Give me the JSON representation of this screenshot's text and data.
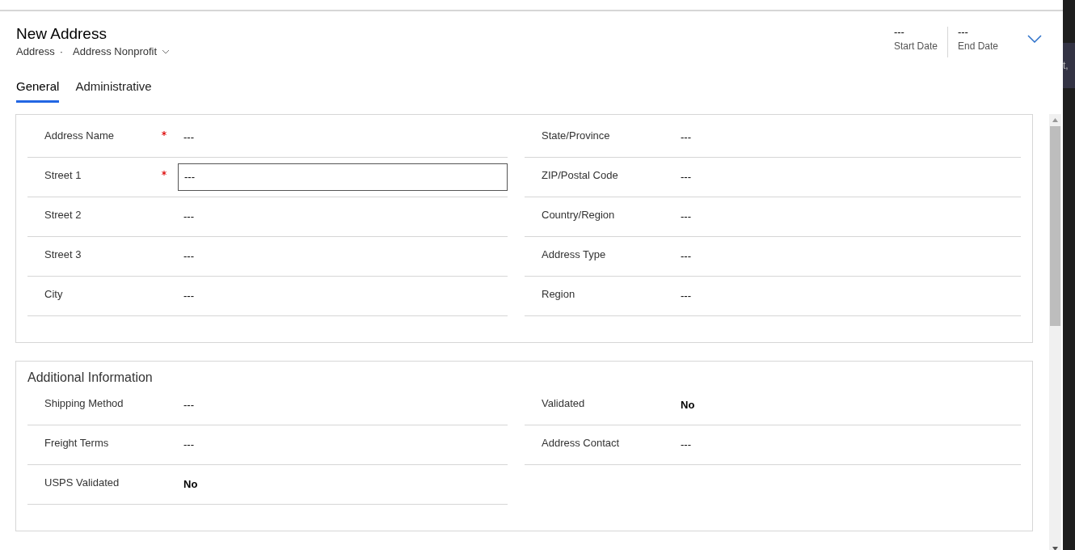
{
  "header": {
    "title": "New Address",
    "entity": "Address",
    "separator": "·",
    "form_name": "Address Nonprofit",
    "fields": [
      {
        "value": "---",
        "label": "Start Date"
      },
      {
        "value": "---",
        "label": "End Date"
      }
    ]
  },
  "tabs": [
    {
      "label": "General",
      "selected": true
    },
    {
      "label": "Administrative",
      "selected": false
    }
  ],
  "sections": [
    {
      "columns": [
        [
          {
            "label": "Address Name",
            "required": true,
            "value": "---",
            "kind": "text",
            "focused": false
          },
          {
            "label": "Street 1",
            "required": true,
            "value": "---",
            "kind": "text",
            "focused": true
          },
          {
            "label": "Street 2",
            "required": false,
            "value": "---",
            "kind": "text",
            "focused": false
          },
          {
            "label": "Street 3",
            "required": false,
            "value": "---",
            "kind": "text",
            "focused": false
          },
          {
            "label": "City",
            "required": false,
            "value": "---",
            "kind": "text",
            "focused": false
          }
        ],
        [
          {
            "label": "State/Province",
            "required": false,
            "value": "---",
            "kind": "text",
            "focused": false
          },
          {
            "label": "ZIP/Postal Code",
            "required": false,
            "value": "---",
            "kind": "text",
            "focused": false
          },
          {
            "label": "Country/Region",
            "required": false,
            "value": "---",
            "kind": "text",
            "focused": false
          },
          {
            "label": "Address Type",
            "required": false,
            "value": "---",
            "kind": "text",
            "focused": false
          },
          {
            "label": "Region",
            "required": false,
            "value": "---",
            "kind": "text",
            "focused": false
          }
        ]
      ]
    },
    {
      "title": "Additional Information",
      "columns": [
        [
          {
            "label": "Shipping Method",
            "required": false,
            "value": "---",
            "kind": "text",
            "focused": false
          },
          {
            "label": "Freight Terms",
            "required": false,
            "value": "---",
            "kind": "text",
            "focused": false
          },
          {
            "label": "USPS Validated",
            "required": false,
            "value": "No",
            "kind": "boolean",
            "focused": false
          }
        ],
        [
          {
            "label": "Validated",
            "required": false,
            "value": "No",
            "kind": "boolean",
            "focused": false
          },
          {
            "label": "Address Contact",
            "required": false,
            "value": "---",
            "kind": "text",
            "focused": false
          }
        ]
      ]
    }
  ],
  "side_panel": {
    "text": "t,"
  }
}
